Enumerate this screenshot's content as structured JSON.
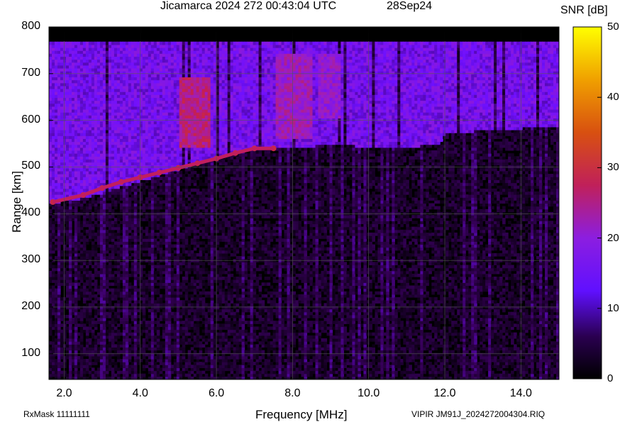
{
  "chart_data": {
    "type": "heatmap",
    "title": "Jicamarca 2024 272 00:43:04 UTC",
    "date": "28Sep24",
    "xlabel": "Frequency [MHz]",
    "ylabel": "Range [km]",
    "colorbar_label": "SNR [dB]",
    "xlim": [
      1.6,
      15.0
    ],
    "ylim": [
      45,
      800
    ],
    "x_ticks": [
      2.0,
      4.0,
      6.0,
      8.0,
      10.0,
      12.0,
      14.0
    ],
    "x_tick_labels": [
      "2.0",
      "4.0",
      "6.0",
      "8.0",
      "10.0",
      "12.0",
      "14.0"
    ],
    "y_ticks": [
      100,
      200,
      300,
      400,
      500,
      600,
      700,
      800
    ],
    "y_tick_labels": [
      "100",
      "200",
      "300",
      "400",
      "500",
      "600",
      "700",
      "800"
    ],
    "colorbar_range": [
      0,
      50
    ],
    "colorbar_ticks": [
      0,
      10,
      20,
      30,
      40,
      50
    ],
    "colorbar_tick_labels": [
      "0",
      "10",
      "20",
      "30",
      "40",
      "50"
    ],
    "colormap": [
      "#000000",
      "#3a0060",
      "#6f10ff",
      "#9a1ec8",
      "#c41e55",
      "#e05000",
      "#f0a000",
      "#ffff00"
    ],
    "grid": true,
    "data_upper_range_km": 765,
    "echo_trace": [
      {
        "freq_mhz": 1.7,
        "range_km": 425
      },
      {
        "freq_mhz": 2.5,
        "range_km": 440
      },
      {
        "freq_mhz": 3.0,
        "range_km": 455
      },
      {
        "freq_mhz": 3.5,
        "range_km": 468
      },
      {
        "freq_mhz": 4.0,
        "range_km": 478
      },
      {
        "freq_mhz": 4.5,
        "range_km": 488
      },
      {
        "freq_mhz": 5.0,
        "range_km": 498
      },
      {
        "freq_mhz": 5.5,
        "range_km": 508
      },
      {
        "freq_mhz": 6.0,
        "range_km": 518
      },
      {
        "freq_mhz": 6.5,
        "range_km": 530
      },
      {
        "freq_mhz": 7.0,
        "range_km": 540
      },
      {
        "freq_mhz": 7.5,
        "range_km": 540
      }
    ],
    "echo_boundary": [
      {
        "freq_mhz": 1.6,
        "range_km": 420
      },
      {
        "freq_mhz": 2.5,
        "range_km": 430
      },
      {
        "freq_mhz": 3.5,
        "range_km": 455
      },
      {
        "freq_mhz": 4.5,
        "range_km": 480
      },
      {
        "freq_mhz": 5.5,
        "range_km": 505
      },
      {
        "freq_mhz": 6.5,
        "range_km": 528
      },
      {
        "freq_mhz": 7.2,
        "range_km": 540
      },
      {
        "freq_mhz": 8.0,
        "range_km": 538
      },
      {
        "freq_mhz": 9.0,
        "range_km": 545
      },
      {
        "freq_mhz": 10.0,
        "range_km": 540
      },
      {
        "freq_mhz": 11.0,
        "range_km": 540
      },
      {
        "freq_mhz": 11.8,
        "range_km": 545
      },
      {
        "freq_mhz": 12.0,
        "range_km": 570
      },
      {
        "freq_mhz": 13.0,
        "range_km": 575
      },
      {
        "freq_mhz": 14.0,
        "range_km": 580
      },
      {
        "freq_mhz": 15.0,
        "range_km": 580
      }
    ],
    "strong_regions": [
      {
        "freq_from": 5.0,
        "freq_to": 5.8,
        "range_from": 540,
        "range_to": 690,
        "snr_db": 28
      },
      {
        "freq_from": 7.5,
        "freq_to": 8.5,
        "range_from": 560,
        "range_to": 740,
        "snr_db": 24
      },
      {
        "freq_from": 8.6,
        "freq_to": 9.2,
        "range_from": 600,
        "range_to": 740,
        "snr_db": 22
      }
    ]
  },
  "footer": {
    "left": "RxMask 11111111",
    "right": "VIPIR  JM91J_2024272004304.RIQ"
  }
}
